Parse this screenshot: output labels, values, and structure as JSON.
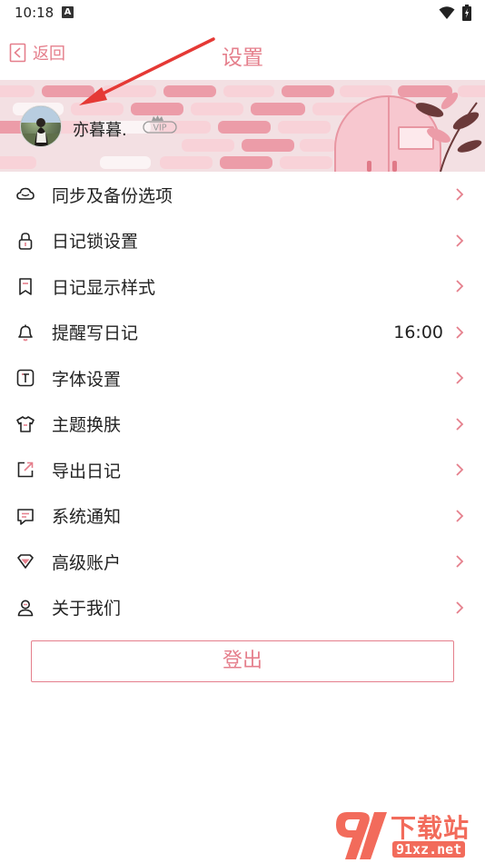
{
  "status_bar": {
    "time": "10:18",
    "notif_glyph": "A"
  },
  "nav": {
    "back_label": "返回",
    "title": "设置"
  },
  "profile": {
    "username": "亦暮暮.",
    "badge": "VIP"
  },
  "menu": [
    {
      "label": "同步及备份选项",
      "icon": "cloud-icon",
      "value": ""
    },
    {
      "label": "日记锁设置",
      "icon": "lock-icon",
      "value": ""
    },
    {
      "label": "日记显示样式",
      "icon": "bookmark-icon",
      "value": ""
    },
    {
      "label": "提醒写日记",
      "icon": "bell-icon",
      "value": "16:00"
    },
    {
      "label": "字体设置",
      "icon": "font-icon",
      "value": ""
    },
    {
      "label": "主题换肤",
      "icon": "tshirt-icon",
      "value": ""
    },
    {
      "label": "导出日记",
      "icon": "export-icon",
      "value": ""
    },
    {
      "label": "系统通知",
      "icon": "message-icon",
      "value": ""
    },
    {
      "label": "高级账户",
      "icon": "diamond-icon",
      "value": ""
    },
    {
      "label": "关于我们",
      "icon": "person-icon",
      "value": ""
    }
  ],
  "logout_label": "登出",
  "watermark": {
    "title": "下载站",
    "url": "91xz.net"
  },
  "colors": {
    "accent": "#e57f8c",
    "annotation_arrow": "#e53935",
    "watermark": "#f26b5b"
  }
}
